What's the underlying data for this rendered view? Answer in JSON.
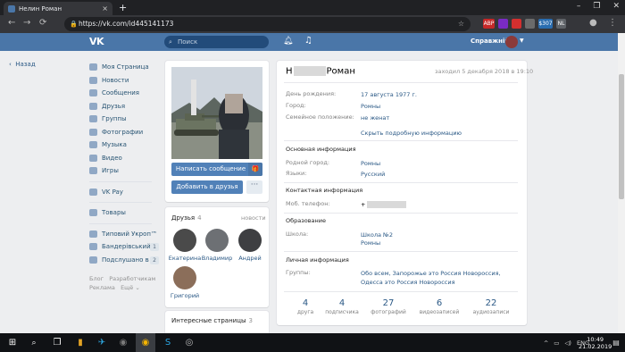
{
  "browser": {
    "tab_title": "Нелин Роман",
    "tab_close": "×",
    "new_tab": "+",
    "window_controls": [
      "–",
      "❐",
      "✕"
    ],
    "url": "https://vk.com/id445141173",
    "extensions": [
      {
        "label": "ABP",
        "color": "#c62828"
      },
      {
        "label": "",
        "color": "#7a2bc4"
      },
      {
        "label": "",
        "color": "#d32f2f"
      },
      {
        "label": "",
        "color": "#6b6b6b"
      },
      {
        "label": "$307",
        "color": "#2a6db0"
      },
      {
        "label": "NL",
        "color": "#5f6368"
      }
    ]
  },
  "vk_header": {
    "logo": "VK",
    "search_placeholder": "Поиск",
    "user_name": "Справжній"
  },
  "back_link": "Назад",
  "nav": {
    "main": [
      "Моя Страница",
      "Новости",
      "Сообщения",
      "Друзья",
      "Группы",
      "Фотографии",
      "Музыка",
      "Видео",
      "Игры"
    ],
    "pay": "VK Pay",
    "goods": "Товары",
    "groups": [
      {
        "label": "Типовий Укроп™",
        "badge": ""
      },
      {
        "label": "Бандерівський ...",
        "badge": "1"
      },
      {
        "label": "Подслушано в ...",
        "badge": "2"
      }
    ],
    "footer_links": [
      "Блог",
      "Разработчикам",
      "Реклама",
      "Ещё ⌄"
    ]
  },
  "profile": {
    "name_start": "Н",
    "name_end": "Роман",
    "online": "заходил 5 декабря 2018 в 19:10",
    "fields": [
      {
        "label": "День рождения:",
        "value": "17 августа 1977 г."
      },
      {
        "label": "Город:",
        "value": "Ромны"
      },
      {
        "label": "Семейное положение:",
        "value": "не женат"
      }
    ],
    "show_more": "Скрыть подробную информацию",
    "sections": {
      "main": "Основная информация",
      "contact": "Контактная информация",
      "education": "Образование",
      "personal": "Личная информация"
    },
    "main_fields": [
      {
        "label": "Родной город:",
        "value": "Ромны"
      },
      {
        "label": "Языки:",
        "value": "Русский"
      }
    ],
    "phone_label": "Моб. телефон:",
    "phone_prefix": "+",
    "school_label": "Школа:",
    "school_value": "Школа №2",
    "school_city": "Ромны",
    "groups_label": "Группы:",
    "groups_value": "Обо всем, Запорожье это Россия Новороссия, Одесса это Россия Новороссия"
  },
  "buttons": {
    "message": "Написать сообщение",
    "add_friend": "Добавить в друзья",
    "more": "···",
    "gift": "🎁"
  },
  "friends": {
    "title": "Друзья",
    "count": "4",
    "news": "новости",
    "list": [
      "Екатерина",
      "Владимир",
      "Андрей",
      "Григорий"
    ]
  },
  "interesting": {
    "title": "Интересные страницы",
    "count": "3"
  },
  "stats": [
    {
      "n": "4",
      "l": "друга"
    },
    {
      "n": "4",
      "l": "подписчика"
    },
    {
      "n": "27",
      "l": "фотографий"
    },
    {
      "n": "6",
      "l": "видеозаписей"
    },
    {
      "n": "22",
      "l": "аудиозаписи"
    }
  ],
  "taskbar": {
    "lang": "ENG",
    "time": "10:49",
    "date": "21.02.2019"
  }
}
